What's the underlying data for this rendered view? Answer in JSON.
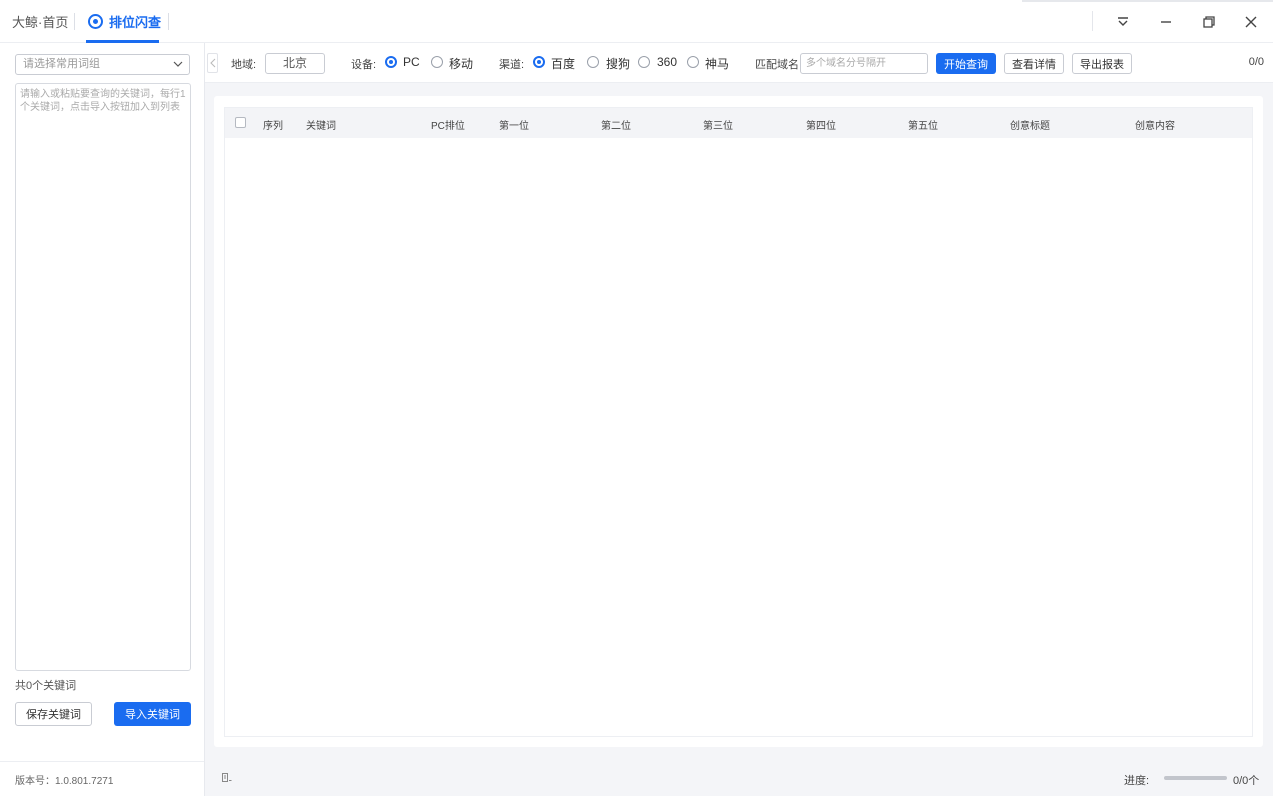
{
  "titlebar": {
    "tabs": [
      {
        "label": "大鲸·首页"
      },
      {
        "label": "排位闪查"
      }
    ]
  },
  "sidebar": {
    "group_placeholder": "请选择常用词组",
    "keyword_placeholder": "请输入或粘贴要查询的关键词，每行1个关键词，点击导入按钮加入到列表",
    "count_text": "共0个关键词",
    "save_label": "保存关键词",
    "import_label": "导入关键词",
    "version": "版本号：1.0.801.7271"
  },
  "toolbar": {
    "region_label": "地域:",
    "region_value": "北京",
    "device_label": "设备:",
    "device_options": [
      {
        "label": "PC",
        "selected": true
      },
      {
        "label": "移动",
        "selected": false
      }
    ],
    "channel_label": "渠道:",
    "channel_options": [
      {
        "label": "百度",
        "selected": true
      },
      {
        "label": "搜狗",
        "selected": false
      },
      {
        "label": "360",
        "selected": false
      },
      {
        "label": "神马",
        "selected": false
      }
    ],
    "domain_label": "匹配域名",
    "domain_placeholder": "多个域名分号隔开",
    "start_label": "开始查询",
    "detail_label": "查看详情",
    "export_label": "导出报表",
    "counter": "0/0"
  },
  "table": {
    "columns": [
      "序列",
      "关键词",
      "PC排位",
      "第一位",
      "第二位",
      "第三位",
      "第四位",
      "第五位",
      "创意标题",
      "创意内容"
    ],
    "rows": []
  },
  "status": {
    "progress_label": "进度:",
    "progress_text": "0/0个",
    "progress_fraction": 0
  },
  "colors": {
    "accent": "#1a6cf0"
  }
}
